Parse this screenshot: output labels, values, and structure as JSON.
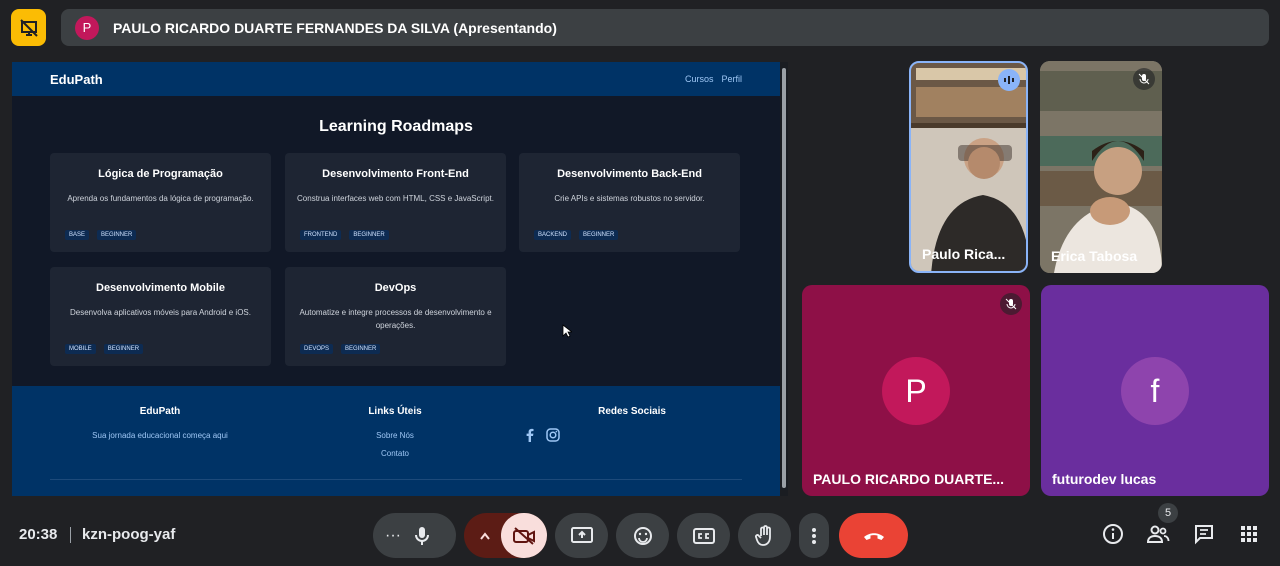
{
  "presenter": {
    "avatar_letter": "P",
    "label": "PAULO RICARDO DUARTE FERNANDES DA SILVA (Apresentando)"
  },
  "shared_screen": {
    "site": {
      "logo": "EduPath",
      "nav": [
        "Cursos",
        "Perfil"
      ]
    },
    "page_title": "Learning Roadmaps",
    "cards": [
      {
        "title": "Lógica de Programação",
        "desc": "Aprenda os fundamentos da lógica de programação.",
        "tags": [
          "BASE",
          "BEGINNER"
        ]
      },
      {
        "title": "Desenvolvimento Front-End",
        "desc": "Construa interfaces web com HTML, CSS e JavaScript.",
        "tags": [
          "FRONTEND",
          "BEGINNER"
        ]
      },
      {
        "title": "Desenvolvimento Back-End",
        "desc": "Crie APIs e sistemas robustos no servidor.",
        "tags": [
          "BACKEND",
          "BEGINNER"
        ]
      },
      {
        "title": "Desenvolvimento Mobile",
        "desc": "Desenvolva aplicativos móveis para Android e iOS.",
        "tags": [
          "MOBILE",
          "BEGINNER"
        ]
      },
      {
        "title": "DevOps",
        "desc": "Automatize e integre processos de desenvolvimento e operações.",
        "tags": [
          "DEVOPS",
          "BEGINNER"
        ]
      }
    ],
    "footer": {
      "col1": {
        "heading": "EduPath",
        "text": "Sua jornada educacional começa aqui"
      },
      "col2": {
        "heading": "Links Úteis",
        "links": [
          "Sobre Nós",
          "Contato"
        ]
      },
      "col3": {
        "heading": "Redes Sociais",
        "icons": [
          "facebook-icon",
          "instagram-icon"
        ]
      }
    }
  },
  "participants": [
    {
      "name": "Paulo Rica...",
      "video": true,
      "speaking": true
    },
    {
      "name": "Erica Tabosa",
      "video": true,
      "muted": true
    },
    {
      "name": "PAULO RICARDO DUARTE...",
      "letter": "P",
      "avatar_color": "#c2185b",
      "muted": true
    },
    {
      "name": "futurodev lucas",
      "letter": "f",
      "avatar_color": "#8e44ad"
    }
  ],
  "bottom_bar": {
    "time": "20:38",
    "meeting_code": "kzn-poog-yaf",
    "participant_count": "5",
    "more_label": "···"
  },
  "colors": {
    "accent_yellow": "#fbbc04",
    "end_call": "#ea4335",
    "site_blue": "#003366"
  }
}
